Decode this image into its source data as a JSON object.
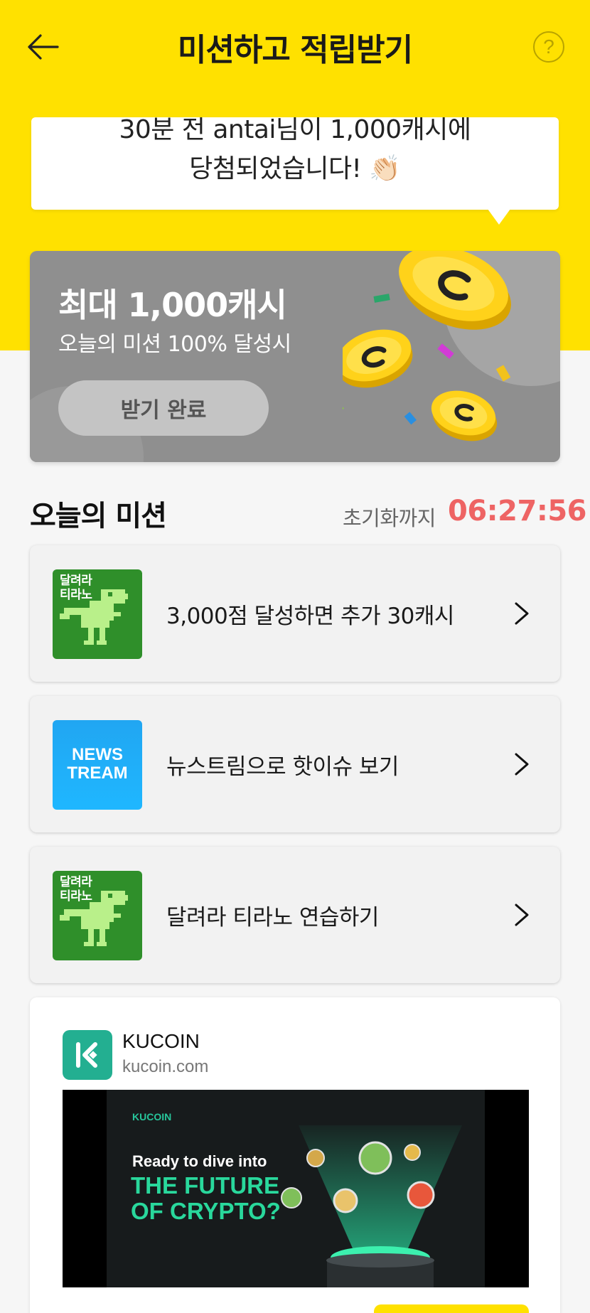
{
  "header": {
    "title": "미션하고 적립받기",
    "back_icon": "back-arrow-icon",
    "help_label": "?"
  },
  "notice": {
    "line1": "30분 전 antai님이 1,000캐시에",
    "line2": "당첨되었습니다! 👏🏻",
    "line3": ""
  },
  "reward": {
    "title": "최대 1,000캐시",
    "subtitle": "오늘의 미션 100% 달성시",
    "button_label": "받기 완료"
  },
  "missions_section": {
    "title": "오늘의 미션",
    "reset_label": "초기화까지",
    "reset_time": "06:27:56"
  },
  "missions": [
    {
      "thumb_text": "달려라\n티라노",
      "label": "3,000점 달성하면 추가 30캐시"
    },
    {
      "thumb_text": "NEWS\nTREAM",
      "label": "뉴스트림으로 핫이슈 보기"
    },
    {
      "thumb_text": "달려라\n티라노",
      "label": "달려라 티라노 연습하기"
    }
  ],
  "ad": {
    "name": "KUCOIN",
    "domain": "kucoin.com",
    "banner_brand": "KUCOIN",
    "banner_line1": "Ready to dive into",
    "banner_line2": "THE FUTURE",
    "banner_line3": "OF CRYPTO?"
  },
  "colors": {
    "brand_yellow": "#ffe100",
    "countdown_red": "#ee6464",
    "kucoin_green": "#23af91"
  }
}
